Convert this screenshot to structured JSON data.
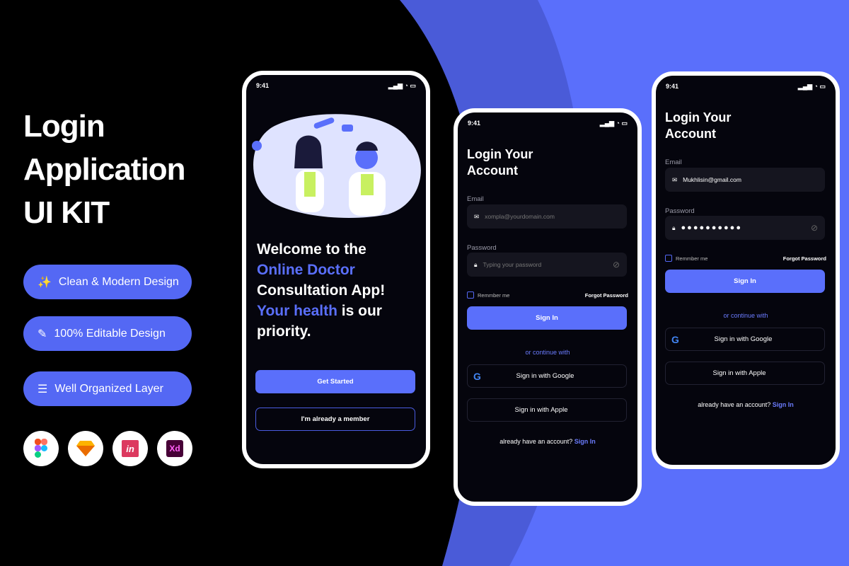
{
  "hero": {
    "line1": "Login",
    "line2": "Application",
    "line3": "UI KIT"
  },
  "features": [
    {
      "label": "Clean & Modern  Design",
      "icon": "magic-wand-icon"
    },
    {
      "label": "100% Editable Design",
      "icon": "edit-icon"
    },
    {
      "label": "Well Organized Layer",
      "icon": "layers-icon"
    }
  ],
  "tools": [
    {
      "name": "Figma",
      "icon": "figma-icon"
    },
    {
      "name": "Sketch",
      "icon": "sketch-icon"
    },
    {
      "name": "InVision",
      "icon": "invision-icon",
      "text": "in"
    },
    {
      "name": "Adobe XD",
      "icon": "xd-icon",
      "text": "Xd"
    }
  ],
  "colors": {
    "accent": "#5a6ffb",
    "background": "#000000",
    "phone_bg": "#05050d"
  },
  "welcome": {
    "time": "9:41",
    "l1": "Welcome to the",
    "l2": "Online Doctor",
    "l3": "Consultation App!",
    "l4a": "Your health",
    "l4b": " is our",
    "l5": "priority.",
    "get_started": "Get Started",
    "member": "I'm already a member"
  },
  "login1": {
    "time": "9:41",
    "title1": "Login Your",
    "title2": "Account",
    "email_label": "Email",
    "email_placeholder": "xompla@yourdomain.com",
    "password_label": "Password",
    "password_placeholder": "Typing your password",
    "remember": "Remmber me",
    "forgot": "Forgot Password",
    "sign_in": "Sign In",
    "or": "or continue with",
    "google": "Sign in with Google",
    "apple": "Sign in with Apple",
    "account": "already have an account?",
    "account_link": "Sign In"
  },
  "login2": {
    "time": "9:41",
    "title1": "Login Your",
    "title2": "Account",
    "email_label": "Email",
    "email_value": "Mukhlisin@gmail.com",
    "password_label": "Password",
    "password_value": "●●●●●●●●●●",
    "remember": "Remmber me",
    "forgot": "Forgot Password",
    "sign_in": "Sign In",
    "or": "or continue with",
    "google": "Sign in with Google",
    "apple": "Sign in with Apple",
    "account": "already have an account?",
    "account_link": "Sign In"
  }
}
